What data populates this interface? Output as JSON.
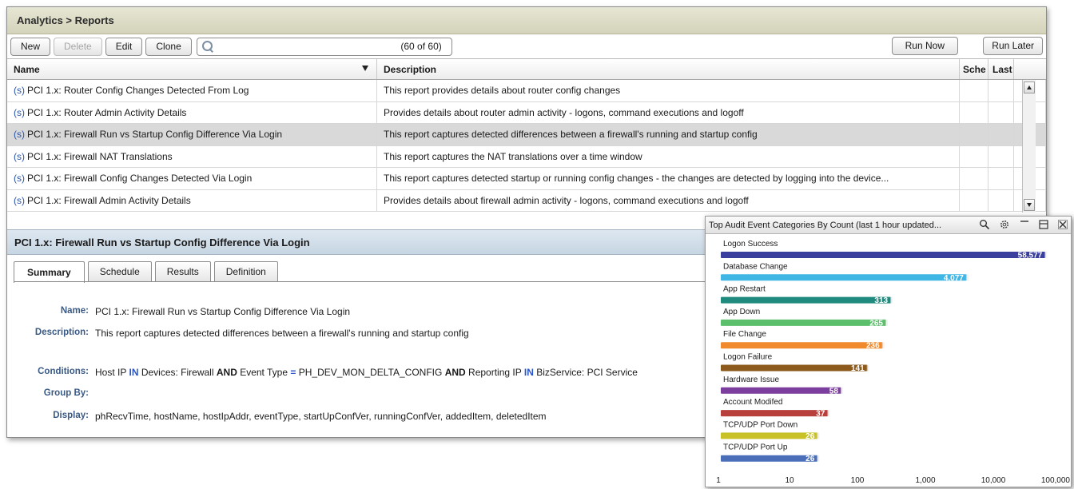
{
  "window": {
    "breadcrumb": "Analytics > Reports"
  },
  "toolbar": {
    "new_label": "New",
    "delete_label": "Delete",
    "edit_label": "Edit",
    "clone_label": "Clone",
    "search_value": "",
    "count": "(60 of 60)",
    "run_now_label": "Run Now",
    "run_later_label": "Run Later"
  },
  "table": {
    "columns": {
      "name": "Name",
      "description": "Description",
      "schedule": "Sche",
      "last": "Last"
    },
    "rows": [
      {
        "prefix": "(s)",
        "name": "PCI 1.x: Router Config Changes Detected From Log",
        "description": "This report provides details about router config changes"
      },
      {
        "prefix": "(s)",
        "name": "PCI 1.x: Router Admin Activity Details",
        "description": "Provides details about router admin activity - logons, command executions and logoff"
      },
      {
        "prefix": "(s)",
        "name": "PCI 1.x: Firewall Run vs Startup Config Difference Via Login",
        "description": "This report captures detected differences between a firewall's running and startup config",
        "selected": true
      },
      {
        "prefix": "(s)",
        "name": "PCI 1.x: Firewall NAT Translations",
        "description": "This report captures the NAT translations over a time window"
      },
      {
        "prefix": "(s)",
        "name": "PCI 1.x: Firewall Config Changes Detected Via Login",
        "description": "This report captures detected startup or running config changes - the changes are detected by logging into the device..."
      },
      {
        "prefix": "(s)",
        "name": "PCI 1.x: Firewall Admin Activity Details",
        "description": "Provides details about firewall admin activity - logons, command executions and logoff"
      }
    ]
  },
  "detail": {
    "title": "PCI 1.x: Firewall Run vs Startup Config Difference Via Login",
    "tabs": [
      "Summary",
      "Schedule",
      "Results",
      "Definition"
    ],
    "active_tab": "Summary",
    "fields": {
      "name_label": "Name:",
      "name_value": "PCI 1.x: Firewall Run vs Startup Config Difference Via Login",
      "description_label": "Description:",
      "description_value": "This report captures detected differences between a firewall's running and startup config",
      "conditions_label": "Conditions:",
      "conditions": {
        "t1": "Host IP",
        "k1": "IN",
        "t2": "Devices: Firewall",
        "k2": "AND",
        "t3": "Event Type",
        "k3": "=",
        "t4": "PH_DEV_MON_DELTA_CONFIG",
        "k4": "AND",
        "t5": "Reporting IP",
        "k5": "IN",
        "t6": "BizService: PCI Service"
      },
      "group_by_label": "Group By:",
      "group_by_value": "",
      "display_label": "Display:",
      "display_value": "phRecvTime, hostName, hostIpAddr, eventType, startUpConfVer, runningConfVer, addedItem, deletedItem"
    }
  },
  "widget": {
    "title": "Top Audit Event Categories By Count (last 1 hour updated...",
    "icons": [
      "search-icon",
      "gear-icon",
      "minimize-icon",
      "maximize-icon",
      "close-icon"
    ]
  },
  "chart_data": {
    "type": "bar",
    "orientation": "horizontal",
    "title": "Top Audit Event Categories By Count (last 1 hour updated...",
    "x_scale": "log",
    "xlim": [
      1,
      100000
    ],
    "x_ticks": [
      "1",
      "10",
      "100",
      "1,000",
      "10,000",
      "100,000"
    ],
    "categories": [
      "Logon Success",
      "Database Change",
      "App Restart",
      "App Down",
      "File Change",
      "Logon Failure",
      "Hardware Issue",
      "Account Modifed",
      "TCP/UDP Port Down",
      "TCP/UDP Port Up"
    ],
    "values": [
      58577,
      4077,
      313,
      265,
      236,
      141,
      58,
      37,
      26,
      26
    ],
    "value_labels": [
      "58,577",
      "4,077",
      "313",
      "265",
      "236",
      "141",
      "58",
      "37",
      "26",
      "26"
    ],
    "colors": [
      "#3a3f9e",
      "#3fb6e4",
      "#1f8a7d",
      "#5cbf6c",
      "#f08a2c",
      "#8b5a1c",
      "#7d3f9e",
      "#b8403c",
      "#c8c228",
      "#4a6fb8"
    ],
    "grid": false,
    "legend": "none"
  }
}
